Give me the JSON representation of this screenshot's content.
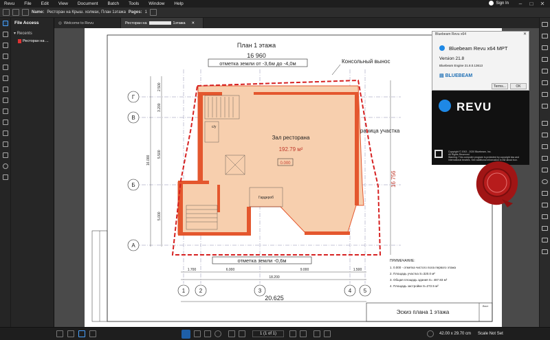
{
  "app": {
    "name": "Revu"
  },
  "menu": [
    "File",
    "Edit",
    "View",
    "Document",
    "Batch",
    "Tools",
    "Window",
    "Help"
  ],
  "account": {
    "sign_in": "Sign In"
  },
  "docbar": {
    "name_label": "Name:",
    "name": "Ресторан на Крыш. холмах, План 1этажа",
    "pages_label": "Pages:",
    "pages": "1"
  },
  "file_access": {
    "title": "File Access",
    "recents_label": "Recents",
    "recent_item": "Ресторан на ..."
  },
  "tabs": [
    {
      "label": "Welcome to Revu"
    },
    {
      "label": "Ресторан на"
    },
    {
      "label": "1этажа"
    }
  ],
  "about": {
    "window_title": "Bluebeam Revu x64",
    "product": "Bluebeam Revu x64 MPT",
    "version": "Version 21.8",
    "engine": "Bluebeam Engine 21.8.0.13613",
    "brand": "BLUEBEAM",
    "terms_button": "Terms...",
    "ok_button": "OK"
  },
  "splash": {
    "logo_text": "REVU",
    "copyright": "Copyright © 2002 - 2020 Bluebeam, Inc.",
    "rights": "All Rights Reserved",
    "disclaimer": "Warning: This computer program is protected by copyright law and international treaties. See additional information in the about box."
  },
  "drawing": {
    "title": "План 1 этажа",
    "overall_width": "16 960",
    "ground_mark_top": "отметка земли от -3,6м до -4,0м",
    "cantilever": "Консольный вынос",
    "site_border": "Граница участка",
    "hall_name": "Зал ресторана",
    "hall_area": "192.79 м²",
    "level_mark": "0.000",
    "wardrobe": "Гардероб",
    "wc": "с/у",
    "right_dimension": "16 756",
    "left_total": "16.000",
    "left_dims": [
      "2.500",
      "3.200",
      "5.500",
      "5.000"
    ],
    "ground_mark_bottom": "отметка земли -0,6м",
    "bottom_dims": [
      "1.700",
      "6.000",
      "9.000",
      "1.500"
    ],
    "bottom_total": "18.200",
    "grand_total": "20.625",
    "grid_rows": [
      "Г",
      "В",
      "Б",
      "А"
    ],
    "grid_cols": [
      "1",
      "2",
      "3",
      "4",
      "5"
    ],
    "notes_title": "ПРИМЕЧАНИЕ:",
    "notes": [
      "1. 0.000 - отметка чистого пола первого этажа",
      "2. Площадь участка       S=320.0 м²",
      "3. Общая площадь здания S= 487.83 м²",
      "4. Площадь застройки   S=272.5 м²"
    ],
    "stamp_title": "Эскиз плана 1 этажа",
    "sheet_label": "Лист",
    "seal_text": "BLUEBEAM"
  },
  "status": {
    "page": "1 (1 of 1)",
    "size": "42.00 x 29.70 cm",
    "scale": "Scale Not Set"
  },
  "colors": {
    "accent": "#1e88e5",
    "hatch": "#e4572e",
    "site_border": "#d62020",
    "fill": "#f7cfae"
  }
}
